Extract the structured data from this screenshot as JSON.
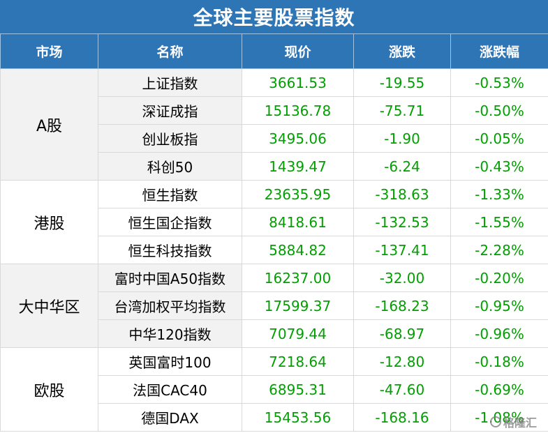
{
  "title": "全球主要股票指数",
  "headers": [
    "市场",
    "名称",
    "现价",
    "涨跌",
    "涨跌幅"
  ],
  "groups": [
    {
      "market": "A股",
      "rows": [
        {
          "name": "上证指数",
          "price": "3661.53",
          "change": "-19.55",
          "pct": "-0.53%"
        },
        {
          "name": "深证成指",
          "price": "15136.78",
          "change": "-75.71",
          "pct": "-0.50%"
        },
        {
          "name": "创业板指",
          "price": "3495.06",
          "change": "-1.90",
          "pct": "-0.05%"
        },
        {
          "name": "科创50",
          "price": "1439.47",
          "change": "-6.24",
          "pct": "-0.43%"
        }
      ]
    },
    {
      "market": "港股",
      "rows": [
        {
          "name": "恒生指数",
          "price": "23635.95",
          "change": "-318.63",
          "pct": "-1.33%"
        },
        {
          "name": "恒生国企指数",
          "price": "8418.61",
          "change": "-132.53",
          "pct": "-1.55%"
        },
        {
          "name": "恒生科技指数",
          "price": "5884.82",
          "change": "-137.41",
          "pct": "-2.28%"
        }
      ]
    },
    {
      "market": "大中华区",
      "rows": [
        {
          "name": "富时中国A50指数",
          "price": "16237.00",
          "change": "-32.00",
          "pct": "-0.20%"
        },
        {
          "name": "台湾加权平均指数",
          "price": "17599.37",
          "change": "-168.23",
          "pct": "-0.95%"
        },
        {
          "name": "中华120指数",
          "price": "7079.44",
          "change": "-68.97",
          "pct": "-0.96%"
        }
      ]
    },
    {
      "market": "欧股",
      "rows": [
        {
          "name": "英国富时100",
          "price": "7218.64",
          "change": "-12.80",
          "pct": "-0.18%"
        },
        {
          "name": "法国CAC40",
          "price": "6895.31",
          "change": "-47.60",
          "pct": "-0.69%"
        },
        {
          "name": "德国DAX",
          "price": "15453.56",
          "change": "-168.16",
          "pct": "-1.08%"
        }
      ]
    }
  ],
  "watermark": "格隆汇",
  "colors": {
    "header_bg": "#2E75B6",
    "value_green": "#00A000",
    "group_gray": "#F2F2F2"
  }
}
